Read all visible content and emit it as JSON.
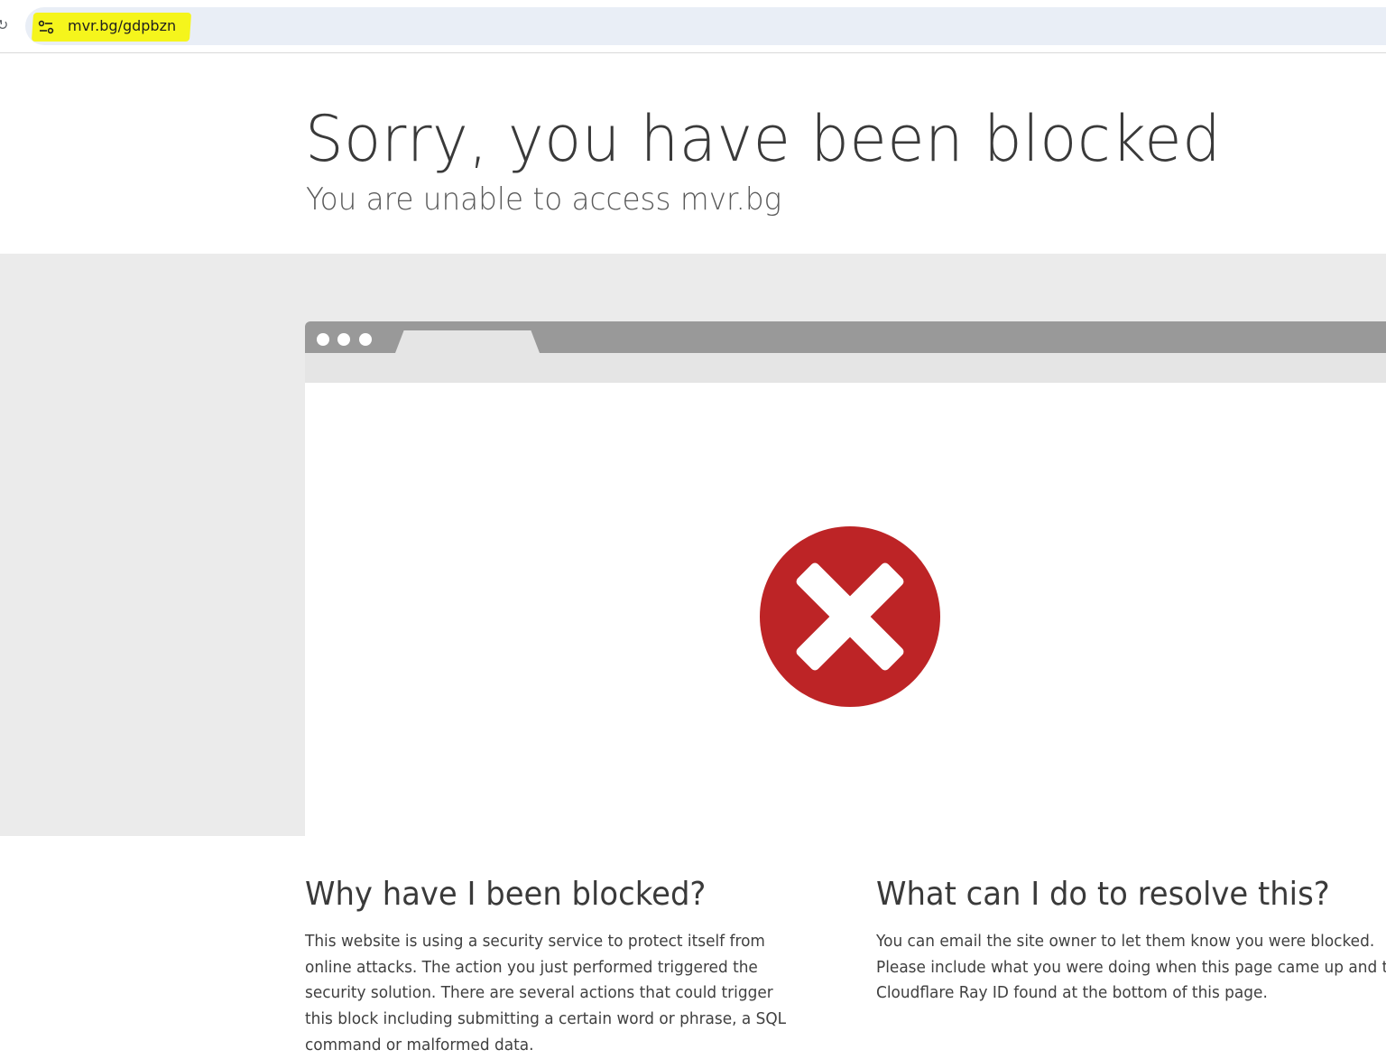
{
  "browser": {
    "url": "mvr.bg/gdpbzn",
    "site_info_icon": "tune-icon",
    "reload_icon": "reload-icon",
    "url_highlight_color": "#f5f51c"
  },
  "header": {
    "title": "Sorry, you have been blocked",
    "subtitle": "You are unable to access mvr.bg"
  },
  "illustration": {
    "icon": "blocked-x-icon",
    "icon_color": "#bd2426"
  },
  "why": {
    "heading": "Why have I been blocked?",
    "body": "This website is using a security service to protect itself from online attacks. The action you just performed triggered the security solution. There are several actions that could trigger this block including submitting a certain word or phrase, a SQL command or malformed data."
  },
  "resolve": {
    "heading": "What can I do to resolve this?",
    "line1": "You can email the site owner to let them know you were blocked.",
    "line2": "Please include what you were doing when this page came up and the",
    "line3": "Cloudflare Ray ID found at the bottom of this page."
  }
}
